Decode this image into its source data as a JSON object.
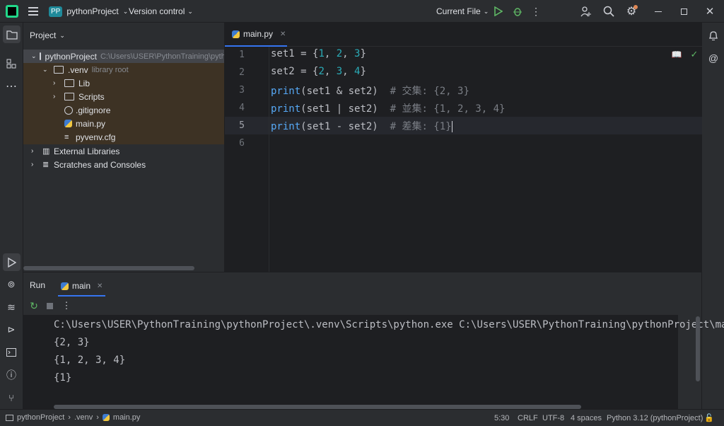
{
  "titlebar": {
    "project_badge": "PP",
    "project_name": "pythonProject",
    "vcs_label": "Version control",
    "run_config": "Current File"
  },
  "project_panel": {
    "title": "Project",
    "tree": [
      {
        "label": "pythonProject",
        "hint": "C:\\Users\\USER\\PythonTraining\\pythonProject"
      },
      {
        "label": ".venv",
        "hint": "library root"
      },
      {
        "label": "Lib"
      },
      {
        "label": "Scripts"
      },
      {
        "label": ".gitignore"
      },
      {
        "label": "main.py"
      },
      {
        "label": "pyvenv.cfg"
      },
      {
        "label": "External Libraries"
      },
      {
        "label": "Scratches and Consoles"
      }
    ]
  },
  "editor": {
    "tab": "main.py",
    "line_numbers": [
      "1",
      "2",
      "3",
      "4",
      "5",
      "6"
    ],
    "lines": [
      {
        "a": "set1 = {",
        "n1": "1",
        ", ": ", ",
        "n2": "2",
        "n3": "3",
        "b": "}"
      },
      {
        "a": "set2 = {",
        "n1": "2",
        "n2": "3",
        "n3": "4",
        "b": "}"
      },
      {
        "fn": "print",
        "body": "(set1 & set2)  ",
        "comment": "# 交集: {2, 3}"
      },
      {
        "fn": "print",
        "body": "(set1 | set2)  ",
        "comment": "# 並集: {1, 2, 3, 4}"
      },
      {
        "fn": "print",
        "body": "(set1 - set2)  ",
        "comment": "# 差集: {1}"
      }
    ]
  },
  "run": {
    "title": "Run",
    "tab": "main",
    "output": [
      "C:\\Users\\USER\\PythonTraining\\pythonProject\\.venv\\Scripts\\python.exe C:\\Users\\USER\\PythonTraining\\pythonProject\\main.py",
      "{2, 3}",
      "{1, 2, 3, 4}",
      "{1}"
    ]
  },
  "statusbar": {
    "crumb_project": "pythonProject",
    "crumb_venv": ".venv",
    "crumb_file": "main.py",
    "position": "5:30",
    "line_sep": "CRLF",
    "encoding": "UTF-8",
    "indent": "4 spaces",
    "interpreter": "Python 3.12 (pythonProject)"
  },
  "colors": {
    "accent": "#3574f0",
    "run_green": "#5fb865",
    "folder_tint": "#3d3224"
  }
}
